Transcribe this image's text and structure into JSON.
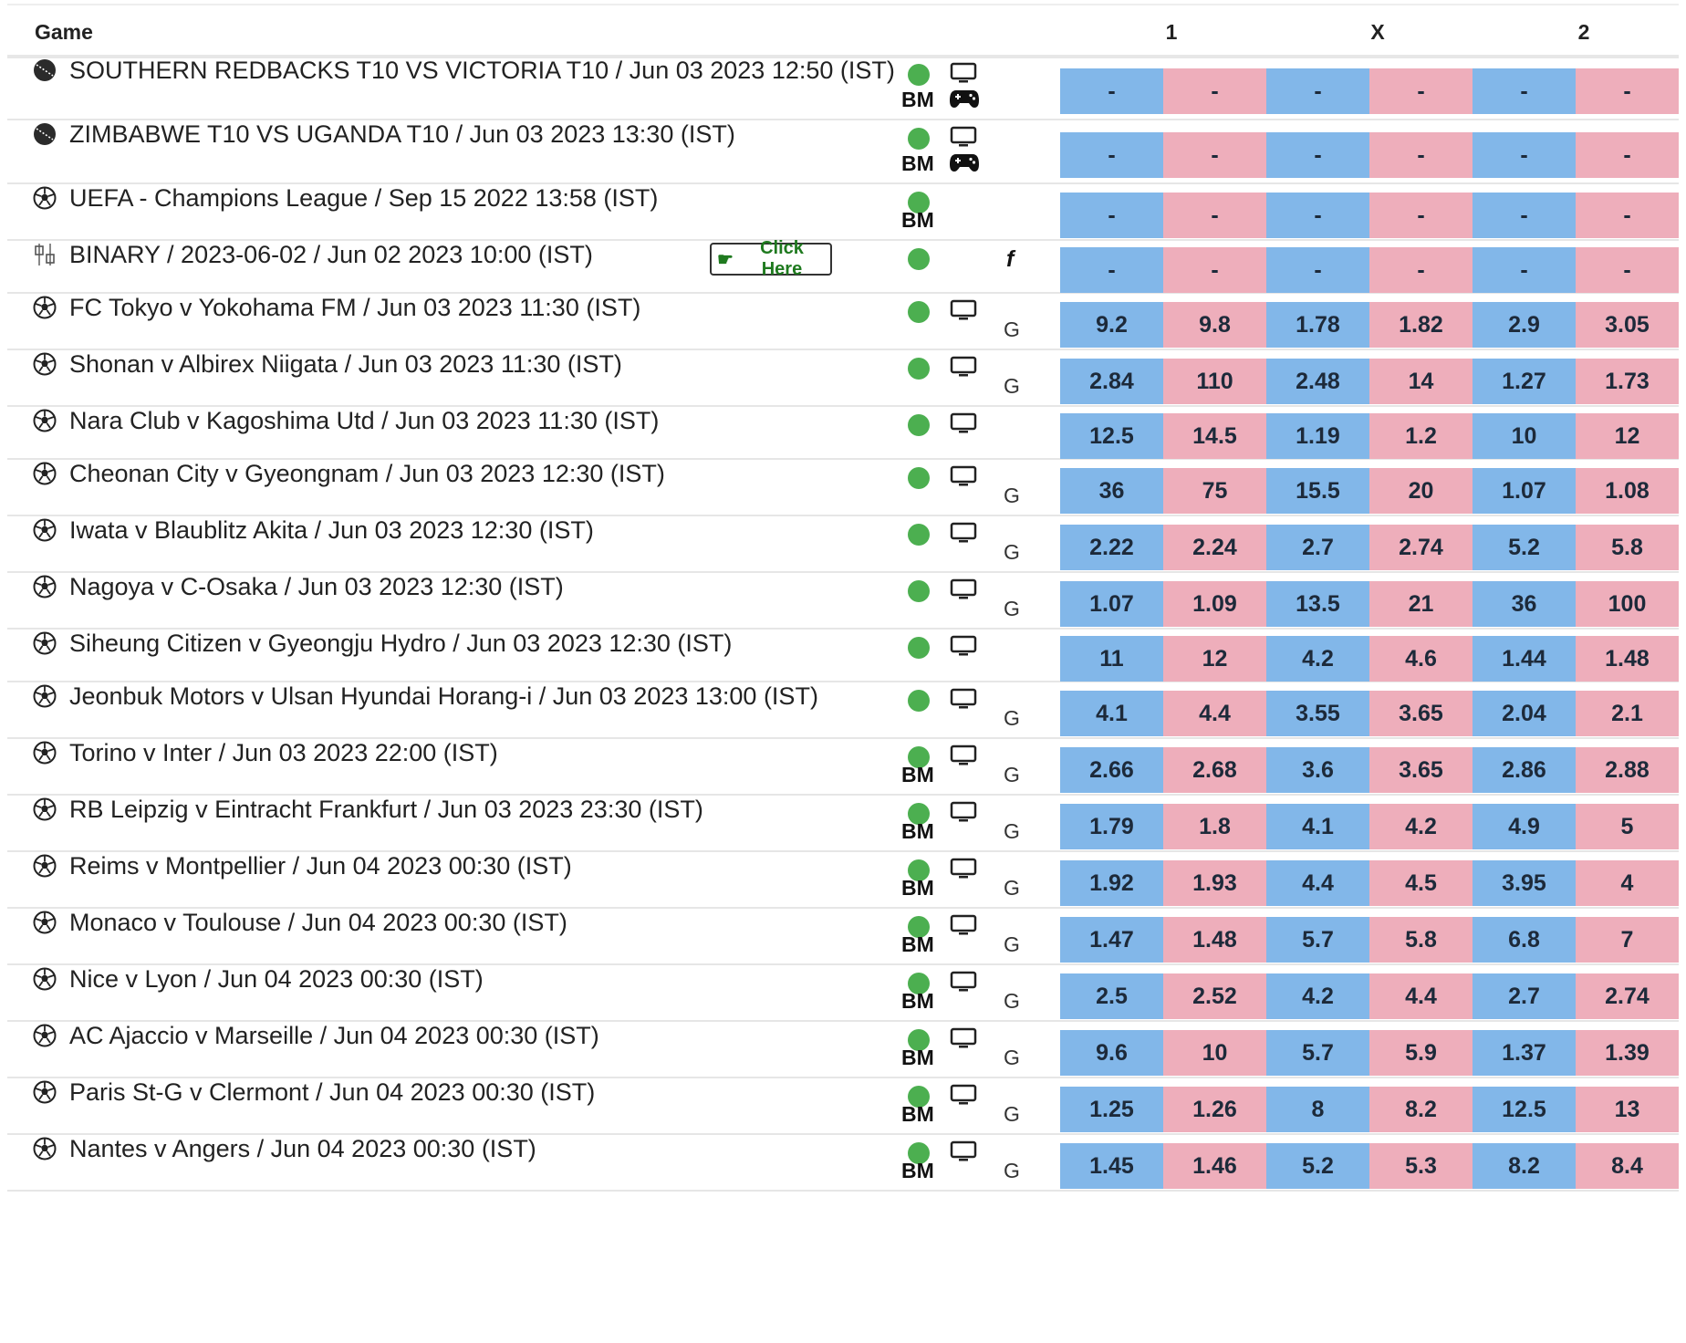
{
  "header": {
    "game": "Game",
    "col1": "1",
    "colx": "X",
    "col2": "2"
  },
  "colors": {
    "back": "#82b7e9",
    "lay": "#eeaebb",
    "live": "#4caf50",
    "button_text": "#1f7a1f"
  },
  "click_button": {
    "label": "Click Here"
  },
  "rows": [
    {
      "sport": "cricket-icon",
      "title": "SOUTHERN REDBACKS T10 VS VICTORIA T10 / Jun 03 2023 12:50 (IST)",
      "bm": "BM",
      "tv": true,
      "game_icon": true,
      "g": "",
      "f": "",
      "odds": [
        "-",
        "-",
        "-",
        "-",
        "-",
        "-"
      ]
    },
    {
      "sport": "cricket-icon",
      "title": "ZIMBABWE T10 VS UGANDA T10 / Jun 03 2023 13:30 (IST)",
      "bm": "BM",
      "tv": true,
      "game_icon": true,
      "g": "",
      "f": "",
      "odds": [
        "-",
        "-",
        "-",
        "-",
        "-",
        "-"
      ]
    },
    {
      "sport": "soccer-icon",
      "title": "UEFA - Champions League / Sep 15 2022 13:58 (IST)",
      "bm": "BM",
      "tv": false,
      "game_icon": false,
      "g": "",
      "f": "",
      "odds": [
        "-",
        "-",
        "-",
        "-",
        "-",
        "-"
      ]
    },
    {
      "sport": "binary-icon",
      "title": "BINARY / 2023-06-02 / Jun 02 2023 10:00 (IST)",
      "bm": "",
      "tv": false,
      "game_icon": false,
      "g": "",
      "f": "f",
      "button": true,
      "odds": [
        "-",
        "-",
        "-",
        "-",
        "-",
        "-"
      ]
    },
    {
      "sport": "soccer-icon",
      "title": "FC Tokyo v Yokohama FM / Jun 03 2023 11:30 (IST)",
      "bm": "",
      "tv": true,
      "game_icon": false,
      "g": "G",
      "f": "",
      "odds": [
        "9.2",
        "9.8",
        "1.78",
        "1.82",
        "2.9",
        "3.05"
      ]
    },
    {
      "sport": "soccer-icon",
      "title": "Shonan v Albirex Niigata / Jun 03 2023 11:30 (IST)",
      "bm": "",
      "tv": true,
      "game_icon": false,
      "g": "G",
      "f": "",
      "odds": [
        "2.84",
        "110",
        "2.48",
        "14",
        "1.27",
        "1.73"
      ]
    },
    {
      "sport": "soccer-icon",
      "title": "Nara Club v Kagoshima Utd / Jun 03 2023 11:30 (IST)",
      "bm": "",
      "tv": true,
      "game_icon": false,
      "g": "",
      "f": "",
      "odds": [
        "12.5",
        "14.5",
        "1.19",
        "1.2",
        "10",
        "12"
      ]
    },
    {
      "sport": "soccer-icon",
      "title": "Cheonan City v Gyeongnam / Jun 03 2023 12:30 (IST)",
      "bm": "",
      "tv": true,
      "game_icon": false,
      "g": "G",
      "f": "",
      "odds": [
        "36",
        "75",
        "15.5",
        "20",
        "1.07",
        "1.08"
      ]
    },
    {
      "sport": "soccer-icon",
      "title": "Iwata v Blaublitz Akita / Jun 03 2023 12:30 (IST)",
      "bm": "",
      "tv": true,
      "game_icon": false,
      "g": "G",
      "f": "",
      "odds": [
        "2.22",
        "2.24",
        "2.7",
        "2.74",
        "5.2",
        "5.8"
      ]
    },
    {
      "sport": "soccer-icon",
      "title": "Nagoya v C-Osaka / Jun 03 2023 12:30 (IST)",
      "bm": "",
      "tv": true,
      "game_icon": false,
      "g": "G",
      "f": "",
      "odds": [
        "1.07",
        "1.09",
        "13.5",
        "21",
        "36",
        "100"
      ]
    },
    {
      "sport": "soccer-icon",
      "title": "Siheung Citizen v Gyeongju Hydro / Jun 03 2023 12:30 (IST)",
      "bm": "",
      "tv": true,
      "game_icon": false,
      "g": "",
      "f": "",
      "odds": [
        "11",
        "12",
        "4.2",
        "4.6",
        "1.44",
        "1.48"
      ]
    },
    {
      "sport": "soccer-icon",
      "title": "Jeonbuk Motors v Ulsan Hyundai Horang-i / Jun 03 2023 13:00 (IST)",
      "bm": "",
      "tv": true,
      "game_icon": false,
      "g": "G",
      "f": "",
      "odds": [
        "4.1",
        "4.4",
        "3.55",
        "3.65",
        "2.04",
        "2.1"
      ]
    },
    {
      "sport": "soccer-icon",
      "title": "Torino v Inter / Jun 03 2023 22:00 (IST)",
      "bm": "BM",
      "tv": true,
      "game_icon": false,
      "g": "G",
      "f": "",
      "odds": [
        "2.66",
        "2.68",
        "3.6",
        "3.65",
        "2.86",
        "2.88"
      ]
    },
    {
      "sport": "soccer-icon",
      "title": "RB Leipzig v Eintracht Frankfurt / Jun 03 2023 23:30 (IST)",
      "bm": "BM",
      "tv": true,
      "game_icon": false,
      "g": "G",
      "f": "",
      "odds": [
        "1.79",
        "1.8",
        "4.1",
        "4.2",
        "4.9",
        "5"
      ]
    },
    {
      "sport": "soccer-icon",
      "title": "Reims v Montpellier / Jun 04 2023 00:30 (IST)",
      "bm": "BM",
      "tv": true,
      "game_icon": false,
      "g": "G",
      "f": "",
      "odds": [
        "1.92",
        "1.93",
        "4.4",
        "4.5",
        "3.95",
        "4"
      ]
    },
    {
      "sport": "soccer-icon",
      "title": "Monaco v Toulouse / Jun 04 2023 00:30 (IST)",
      "bm": "BM",
      "tv": true,
      "game_icon": false,
      "g": "G",
      "f": "",
      "odds": [
        "1.47",
        "1.48",
        "5.7",
        "5.8",
        "6.8",
        "7"
      ]
    },
    {
      "sport": "soccer-icon",
      "title": "Nice v Lyon / Jun 04 2023 00:30 (IST)",
      "bm": "BM",
      "tv": true,
      "game_icon": false,
      "g": "G",
      "f": "",
      "odds": [
        "2.5",
        "2.52",
        "4.2",
        "4.4",
        "2.7",
        "2.74"
      ]
    },
    {
      "sport": "soccer-icon",
      "title": "AC Ajaccio v Marseille / Jun 04 2023 00:30 (IST)",
      "bm": "BM",
      "tv": true,
      "game_icon": false,
      "g": "G",
      "f": "",
      "odds": [
        "9.6",
        "10",
        "5.7",
        "5.9",
        "1.37",
        "1.39"
      ]
    },
    {
      "sport": "soccer-icon",
      "title": "Paris St-G v Clermont / Jun 04 2023 00:30 (IST)",
      "bm": "BM",
      "tv": true,
      "game_icon": false,
      "g": "G",
      "f": "",
      "odds": [
        "1.25",
        "1.26",
        "8",
        "8.2",
        "12.5",
        "13"
      ]
    },
    {
      "sport": "soccer-icon",
      "title": "Nantes v Angers / Jun 04 2023 00:30 (IST)",
      "bm": "BM",
      "tv": true,
      "game_icon": false,
      "g": "G",
      "f": "",
      "odds": [
        "1.45",
        "1.46",
        "5.2",
        "5.3",
        "8.2",
        "8.4"
      ]
    }
  ]
}
